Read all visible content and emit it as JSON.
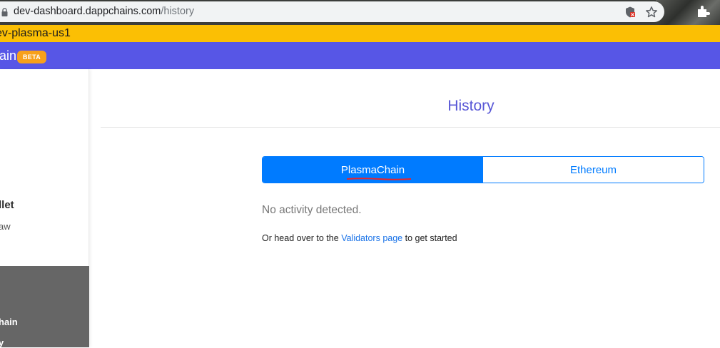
{
  "browser": {
    "url_host": "dev-dashboard.dappchains.com",
    "url_path": "/history",
    "icons": [
      "lock-icon",
      "shield-icon",
      "star-icon",
      "extension-icon"
    ]
  },
  "env_banner": {
    "text": "ev-plasma-us1"
  },
  "header": {
    "brand": "ain",
    "badge": "BETA",
    "color": "#5756e6",
    "badge_color": "#f7a01b"
  },
  "sidebar": {
    "wallet_title": "llet",
    "wallet_subtitle": "aw",
    "dark_items": [
      "hain",
      "y"
    ]
  },
  "main": {
    "title": "History",
    "tabs": [
      {
        "label": "PlasmaChain",
        "active": true
      },
      {
        "label": "Ethereum",
        "active": false
      }
    ],
    "empty_message": "No activity detected.",
    "cta": {
      "prefix": "Or head over to the",
      "link": "Validators page",
      "suffix": "to get started"
    }
  },
  "colors": {
    "accent": "#007bff",
    "banner": "#fbbf04"
  }
}
